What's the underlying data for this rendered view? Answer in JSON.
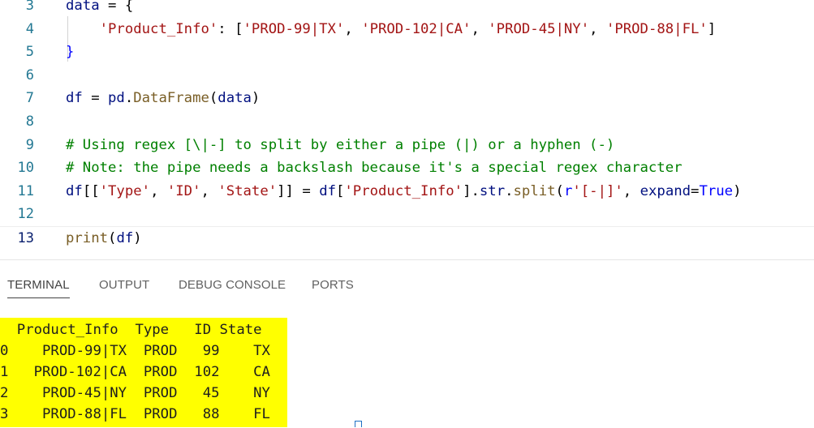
{
  "editor": {
    "lines": [
      {
        "num": "3",
        "tokens": [
          {
            "t": "data",
            "c": "var"
          },
          {
            "t": " = {",
            "c": "op"
          }
        ]
      },
      {
        "num": "4",
        "tokens": [
          {
            "t": "    ",
            "c": "op"
          },
          {
            "t": "'Product_Info'",
            "c": "str"
          },
          {
            "t": ": [",
            "c": "op"
          },
          {
            "t": "'PROD-99|TX'",
            "c": "str"
          },
          {
            "t": ", ",
            "c": "op"
          },
          {
            "t": "'PROD-102|CA'",
            "c": "str"
          },
          {
            "t": ", ",
            "c": "op"
          },
          {
            "t": "'PROD-45|NY'",
            "c": "str"
          },
          {
            "t": ", ",
            "c": "op"
          },
          {
            "t": "'PROD-88|FL'",
            "c": "str"
          },
          {
            "t": "]",
            "c": "op"
          }
        ]
      },
      {
        "num": "5",
        "tokens": [
          {
            "t": "}",
            "c": "kw"
          }
        ]
      },
      {
        "num": "6",
        "tokens": []
      },
      {
        "num": "7",
        "tokens": [
          {
            "t": "df",
            "c": "var"
          },
          {
            "t": " = ",
            "c": "op"
          },
          {
            "t": "pd",
            "c": "var"
          },
          {
            "t": ".",
            "c": "op"
          },
          {
            "t": "DataFrame",
            "c": "fn"
          },
          {
            "t": "(",
            "c": "op"
          },
          {
            "t": "data",
            "c": "var"
          },
          {
            "t": ")",
            "c": "op"
          }
        ]
      },
      {
        "num": "8",
        "tokens": []
      },
      {
        "num": "9",
        "tokens": [
          {
            "t": "# Using regex [\\|-] to split by either a pipe (|) or a hyphen (-)",
            "c": "cm"
          }
        ]
      },
      {
        "num": "10",
        "tokens": [
          {
            "t": "# Note: the pipe needs a backslash because it's a special regex character",
            "c": "cm"
          }
        ]
      },
      {
        "num": "11",
        "tokens": [
          {
            "t": "df",
            "c": "var"
          },
          {
            "t": "[[",
            "c": "op"
          },
          {
            "t": "'Type'",
            "c": "str"
          },
          {
            "t": ", ",
            "c": "op"
          },
          {
            "t": "'ID'",
            "c": "str"
          },
          {
            "t": ", ",
            "c": "op"
          },
          {
            "t": "'State'",
            "c": "str"
          },
          {
            "t": "]] = ",
            "c": "op"
          },
          {
            "t": "df",
            "c": "var"
          },
          {
            "t": "[",
            "c": "op"
          },
          {
            "t": "'Product_Info'",
            "c": "str"
          },
          {
            "t": "].",
            "c": "op"
          },
          {
            "t": "str",
            "c": "var"
          },
          {
            "t": ".",
            "c": "op"
          },
          {
            "t": "split",
            "c": "fn"
          },
          {
            "t": "(",
            "c": "op"
          },
          {
            "t": "r",
            "c": "kw"
          },
          {
            "t": "'[-|]'",
            "c": "str"
          },
          {
            "t": ", ",
            "c": "op"
          },
          {
            "t": "expand",
            "c": "var"
          },
          {
            "t": "=",
            "c": "op"
          },
          {
            "t": "True",
            "c": "kw"
          },
          {
            "t": ")",
            "c": "op"
          }
        ]
      },
      {
        "num": "12",
        "tokens": []
      },
      {
        "num": "13",
        "tokens": [
          {
            "t": "print",
            "c": "fn"
          },
          {
            "t": "(",
            "c": "op"
          },
          {
            "t": "df",
            "c": "var"
          },
          {
            "t": ")",
            "c": "op"
          }
        ]
      }
    ],
    "active_line": "13"
  },
  "panel": {
    "tabs": [
      {
        "label": "TERMINAL",
        "active": true
      },
      {
        "label": "OUTPUT",
        "active": false
      },
      {
        "label": "DEBUG CONSOLE",
        "active": false
      },
      {
        "label": "PORTS",
        "active": false
      }
    ]
  },
  "terminal": {
    "lines": [
      "  Product_Info  Type   ID State",
      "0    PROD-99|TX  PROD   99    TX",
      "1   PROD-102|CA  PROD  102    CA",
      "2    PROD-45|NY  PROD   45    NY",
      "3    PROD-88|FL  PROD   88    FL"
    ]
  },
  "colors": {
    "keyword": "#0000ff",
    "string": "#a31515",
    "function": "#795e26",
    "variable": "#001080",
    "comment": "#008000",
    "line_number": "#237893",
    "highlight": "#ffff00"
  }
}
